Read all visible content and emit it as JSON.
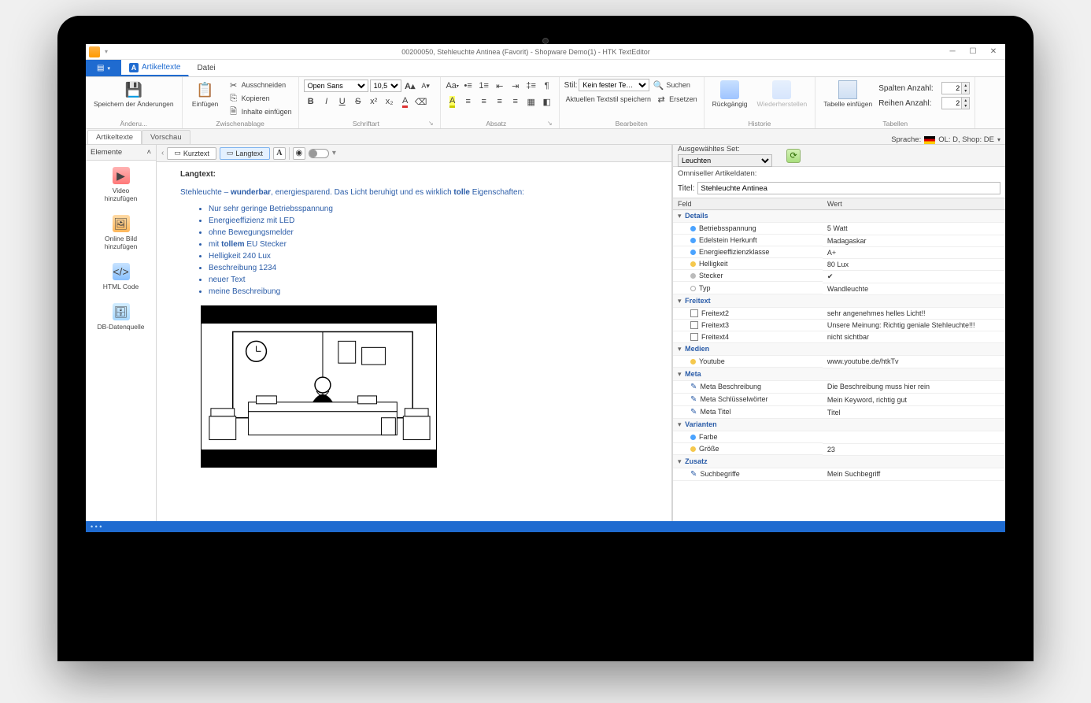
{
  "window": {
    "title": "00200050, Stehleuchte Antinea (Favorit) - Shopware Demo(1) - HTK TextEditor"
  },
  "file_tab": "",
  "ribbon_tabs": {
    "artikeltexte": "Artikeltexte",
    "datei": "Datei"
  },
  "ribbon": {
    "group_changes": {
      "save": "Speichern der\nÄnderungen",
      "label": "Änderu..."
    },
    "group_clipboard": {
      "paste": "Einfügen",
      "cut": "Ausschneiden",
      "copy": "Kopieren",
      "paste_contents": "Inhalte einfügen",
      "label": "Zwischenablage"
    },
    "group_font": {
      "font": "Open Sans",
      "size": "10,5",
      "label": "Schriftart"
    },
    "group_paragraph": {
      "label": "Absatz"
    },
    "group_edit": {
      "style_label": "Stil:",
      "style_value": "Kein fester Te…",
      "save_style": "Aktuellen Textstil speichern",
      "find": "Suchen",
      "replace": "Ersetzen",
      "label": "Bearbeiten"
    },
    "group_history": {
      "undo": "Rückgängig",
      "redo": "Wiederherstellen",
      "label": "Historie"
    },
    "group_tables": {
      "insert": "Tabelle\neinfügen",
      "cols_label": "Spalten Anzahl:",
      "rows_label": "Reihen Anzahl:",
      "cols": "2",
      "rows": "2",
      "label": "Tabellen"
    }
  },
  "subtabs": {
    "artikeltexte": "Artikeltexte",
    "vorschau": "Vorschau",
    "language_label": "Sprache:",
    "language_value": "OL: D, Shop: DE"
  },
  "sidebar": {
    "title": "Elemente",
    "items": [
      {
        "label": "Video\nhinzufügen"
      },
      {
        "label": "Online Bild\nhinzufügen"
      },
      {
        "label": "HTML Code"
      },
      {
        "label": "DB-Datenquelle"
      }
    ]
  },
  "view_toolbar": {
    "kurztext": "Kurztext",
    "langtext": "Langtext"
  },
  "longtext": {
    "heading": "Langtext:",
    "intro_1": "Stehleuchte – ",
    "intro_bold1": "wunderbar",
    "intro_2": ", energiesparend. Das Licht beruhigt und es wirklich ",
    "intro_bold2": "tolle",
    "intro_3": " Eigenschaften:",
    "bullets": [
      "Nur sehr geringe Betriebsspannung",
      "Energieeffizienz mit LED",
      "ohne Bewegungsmelder",
      "mit tollem EU Stecker",
      "Helligkeit 240 Lux",
      "Beschreibung 1234",
      "neuer Text",
      "meine Beschreibung"
    ]
  },
  "right": {
    "set_label": "Ausgewähltes Set:",
    "set_value": "Leuchten",
    "omni_label": "Omniseller Artikeldaten:",
    "titel_label": "Titel:",
    "titel_value": "Stehleuchte Antinea",
    "col_field": "Feld",
    "col_value": "Wert",
    "groups": {
      "details": "Details",
      "freitext": "Freitext",
      "medien": "Medien",
      "meta": "Meta",
      "varianten": "Varianten",
      "zusatz": "Zusatz"
    },
    "details": [
      {
        "k": "Betriebsspannung",
        "v": "5 Watt",
        "c": "d-blue"
      },
      {
        "k": "Edelstein Herkunft",
        "v": "Madagaskar",
        "c": "d-blue"
      },
      {
        "k": "Energieeffizienzklasse",
        "v": "A+",
        "c": "d-blue"
      },
      {
        "k": "Helligkeit",
        "v": "80 Lux",
        "c": "d-yel"
      },
      {
        "k": "Stecker",
        "v": "✔",
        "c": "d-gry"
      },
      {
        "k": "Typ",
        "v": "Wandleuchte",
        "c": "d-wht"
      }
    ],
    "freitext": [
      {
        "k": "Freitext2",
        "v": "sehr angenehmes helles Licht!!"
      },
      {
        "k": "Freitext3",
        "v": "Unsere Meinung: Richtig geniale Stehleuchte!!!"
      },
      {
        "k": "Freitext4",
        "v": "nicht sichtbar"
      }
    ],
    "medien": [
      {
        "k": "Youtube",
        "v": "www.youtube.de/htkTv",
        "c": "d-yel"
      }
    ],
    "meta": [
      {
        "k": "Meta Beschreibung",
        "v": "Die Beschreibung muss hier rein"
      },
      {
        "k": "Meta Schlüsselwörter",
        "v": "Mein Keyword, richtig gut"
      },
      {
        "k": "Meta Titel",
        "v": "Titel"
      }
    ],
    "varianten": [
      {
        "k": "Farbe",
        "v": "",
        "c": "d-blue"
      },
      {
        "k": "Größe",
        "v": "23",
        "c": "d-yel"
      }
    ],
    "zusatz": [
      {
        "k": "Suchbegriffe",
        "v": "Mein Suchbegriff"
      }
    ]
  }
}
